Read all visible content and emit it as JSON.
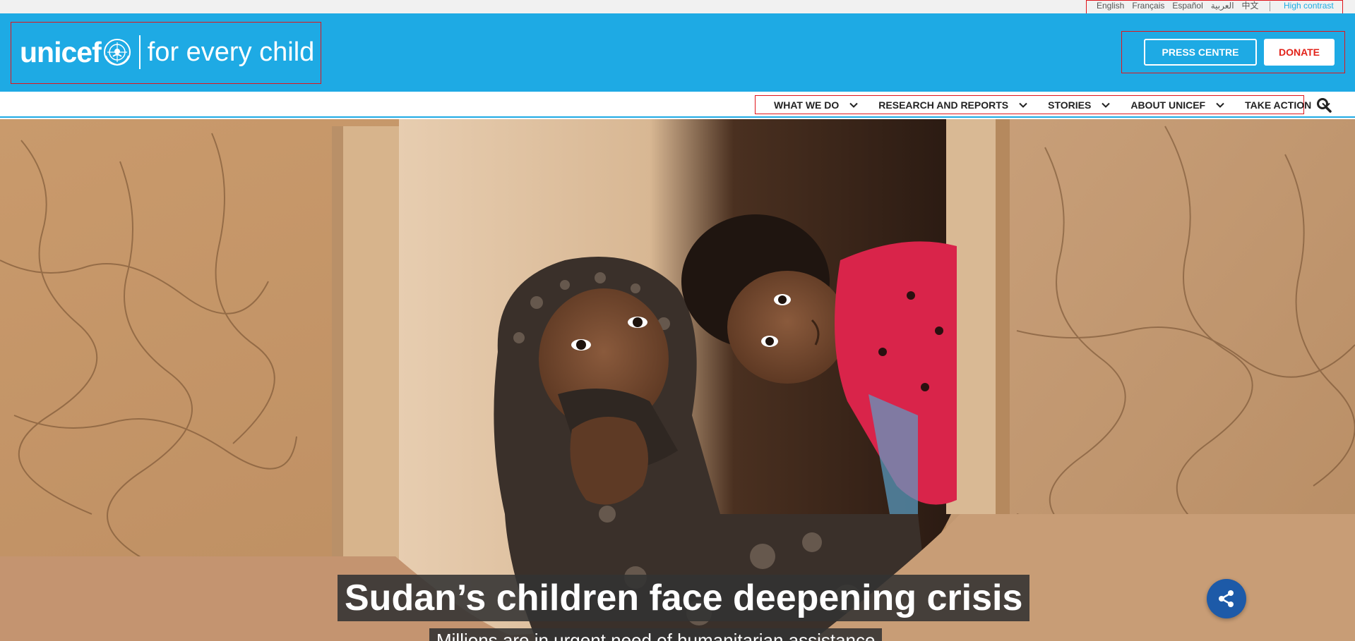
{
  "utility": {
    "languages": [
      "English",
      "Français",
      "Español",
      "العربية",
      "中文"
    ],
    "high_contrast": "High contrast"
  },
  "header": {
    "logo_wordmark": "unicef",
    "logo_tagline": "for every child",
    "press_centre": "PRESS CENTRE",
    "donate": "DONATE"
  },
  "nav": {
    "items": [
      {
        "label": "WHAT WE DO"
      },
      {
        "label": "RESEARCH AND REPORTS"
      },
      {
        "label": "STORIES"
      },
      {
        "label": "ABOUT UNICEF"
      },
      {
        "label": "TAKE ACTION"
      }
    ]
  },
  "hero": {
    "headline": "Sudan’s children face deepening crisis",
    "subhead": "Millions are in urgent need of humanitarian assistance"
  },
  "colors": {
    "brand_blue": "#1eaae4",
    "donate_red": "#e2231a",
    "share_blue": "#1d5aa8"
  }
}
